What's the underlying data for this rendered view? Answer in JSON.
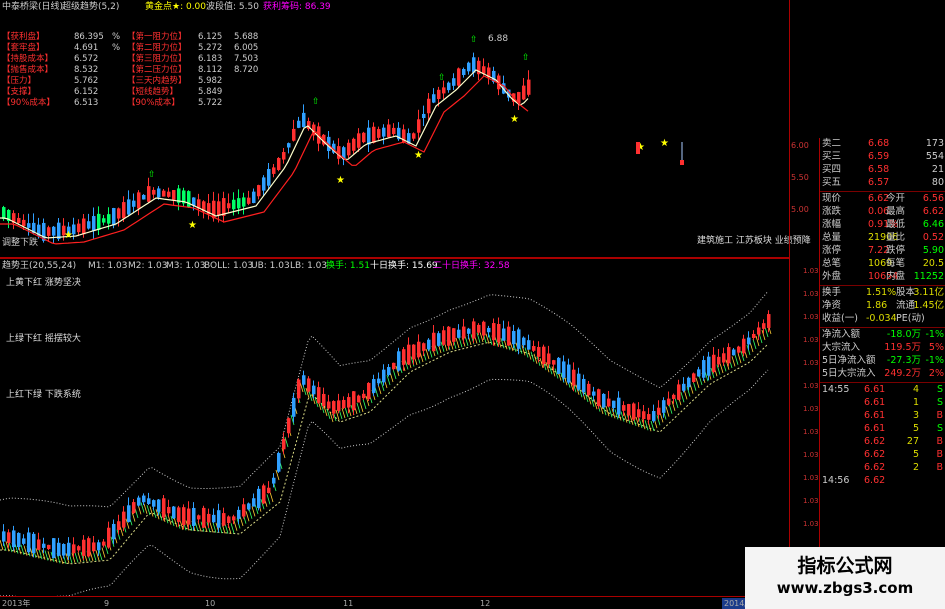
{
  "top_indicator_bar": {
    "items": [
      {
        "text": "中泰桥梁(日线)",
        "color": "#cccccc"
      },
      {
        "text": "超级趋势(5,2)",
        "color": "#cccccc"
      },
      {
        "text": "黄金点★: 0.00",
        "color": "#ffff00"
      },
      {
        "text": "波段值: 5.50",
        "color": "#cccccc"
      },
      {
        "text": "获利筹码: 86.39",
        "color": "#ff00ff"
      }
    ]
  },
  "left_stats": [
    {
      "label": "【获利盘】",
      "value": "86.395",
      "unit": "%",
      "label2": "【第一阻力位】",
      "v1": "6.125",
      "v2": "5.688"
    },
    {
      "label": "【套牢盘】",
      "value": "4.691",
      "unit": "%",
      "label2": "【第二阻力位】",
      "v1": "5.272",
      "v2": "6.005"
    },
    {
      "label": "【持股成本】",
      "value": "6.572",
      "unit": "",
      "label2": "【第三阻力位】",
      "v1": "6.183",
      "v2": "7.503"
    },
    {
      "label": "【抛售成本】",
      "value": "8.532",
      "unit": "",
      "label2": "【第二压力位】",
      "v1": "8.112",
      "v2": "8.720"
    },
    {
      "label": "【压力】",
      "value": "5.762",
      "unit": "",
      "label2": "【三天内趋势】",
      "v1": "5.982",
      "v2": ""
    },
    {
      "label": "【支撑】",
      "value": "6.152",
      "unit": "",
      "label2": "【短线趋势】",
      "v1": "5.849",
      "v2": ""
    },
    {
      "label": "【90%成本】",
      "value": "6.513",
      "unit": "",
      "label2": "【90%成本】",
      "v1": "5.722",
      "v2": ""
    }
  ],
  "main_price_axis": [
    "6.00",
    "5.50",
    "5.00"
  ],
  "main_annotation": "6.88",
  "bottom_left_label": "调整下跌",
  "news_label": "建筑施工 江苏板块 业绩预降",
  "sub_indicator_bar": [
    {
      "text": "趋势王(20,55,24)",
      "color": "#cccccc"
    },
    {
      "text": "M1: 1.03",
      "color": "#cccccc"
    },
    {
      "text": "M2: 1.03",
      "color": "#cccccc"
    },
    {
      "text": "M3: 1.03",
      "color": "#cccccc"
    },
    {
      "text": "BOLL: 1.03",
      "color": "#cccccc"
    },
    {
      "text": "UB: 1.03",
      "color": "#cccccc"
    },
    {
      "text": "LB: 1.03",
      "color": "#cccccc"
    },
    {
      "text": "换手: 1.51",
      "color": "#00ff00"
    },
    {
      "text": "十日换手: 15.69",
      "color": "#ffffff"
    },
    {
      "text": "二十日换手: 32.58",
      "color": "#ff00ff"
    }
  ],
  "sub_labels": [
    "上黄下红  涨势坚决",
    "上绿下红  摇摆较大",
    "上红下绿  下跌系统"
  ],
  "sub_axis": [
    "1.03",
    "1.03",
    "1.03",
    "1.03",
    "1.03",
    "1.03",
    "1.03",
    "1.03",
    "1.03",
    "1.03",
    "1.03",
    "1.03"
  ],
  "time_axis": [
    "2013年",
    "9",
    "10",
    "11",
    "12",
    "2014/1"
  ],
  "quote_panel": {
    "order_book": [
      {
        "label": "卖二",
        "price": "6.68",
        "vol": "173"
      },
      {
        "label": "买三",
        "price": "6.59",
        "vol": "554"
      },
      {
        "label": "买四",
        "price": "6.58",
        "vol": "21"
      },
      {
        "label": "买五",
        "price": "6.57",
        "vol": "80"
      }
    ],
    "stats": [
      {
        "l1": "现价",
        "v1": "6.62",
        "l2": "今开",
        "v2": "6.56"
      },
      {
        "l1": "涨跌",
        "v1": "0.06",
        "l2": "最高",
        "v2": "6.62"
      },
      {
        "l1": "涨幅",
        "v1": "0.91%",
        "l2": "最低",
        "v2": "6.46"
      },
      {
        "l1": "总量",
        "v1": "21906",
        "l2": "量比",
        "v2": "0.52"
      },
      {
        "l1": "涨停",
        "v1": "7.22",
        "l2": "跌停",
        "v2": "5.90"
      },
      {
        "l1": "总笔",
        "v1": "1069",
        "l2": "每笔",
        "v2": "20.5"
      },
      {
        "l1": "外盘",
        "v1": "10654",
        "l2": "内盘",
        "v2": "11252"
      }
    ],
    "stats2": [
      {
        "l1": "换手",
        "v1": "1.51%",
        "l2": "股本",
        "v2": "3.11亿"
      },
      {
        "l1": "净资",
        "v1": "1.86",
        "l2": "流通",
        "v2": "1.45亿"
      },
      {
        "l1": "收益(一)",
        "v1": "-0.034",
        "l2": "PE(动)",
        "v2": ""
      }
    ],
    "flows": [
      {
        "label": "净流入额",
        "value": "-18.0万",
        "pct": "-1%"
      },
      {
        "label": "大宗流入",
        "value": "119.5万",
        "pct": "5%"
      },
      {
        "label": "5日净流入额",
        "value": "-27.3万",
        "pct": "-1%"
      },
      {
        "label": "5日大宗流入",
        "value": "249.2万",
        "pct": "2%"
      }
    ],
    "ticks": [
      {
        "time": "14:55",
        "price": "6.61",
        "vol": "4",
        "side": "S"
      },
      {
        "time": "",
        "price": "6.61",
        "vol": "1",
        "side": "S"
      },
      {
        "time": "",
        "price": "6.61",
        "vol": "3",
        "side": "B"
      },
      {
        "time": "",
        "price": "6.61",
        "vol": "5",
        "side": "S"
      },
      {
        "time": "",
        "price": "6.62",
        "vol": "27",
        "side": "B"
      },
      {
        "time": "",
        "price": "6.62",
        "vol": "5",
        "side": "B"
      },
      {
        "time": "",
        "price": "6.62",
        "vol": "2",
        "side": "B"
      },
      {
        "time": "14:56",
        "price": "6.62",
        "vol": "",
        "side": ""
      }
    ]
  },
  "watermark": {
    "line1": "指标公式网",
    "line2": "www.zbgs3.com"
  },
  "colors": {
    "up": "#ff3030",
    "down": "#30a0ff",
    "signal": "#00ff00",
    "star": "#ffff00",
    "axis_red": "#aa0000"
  }
}
